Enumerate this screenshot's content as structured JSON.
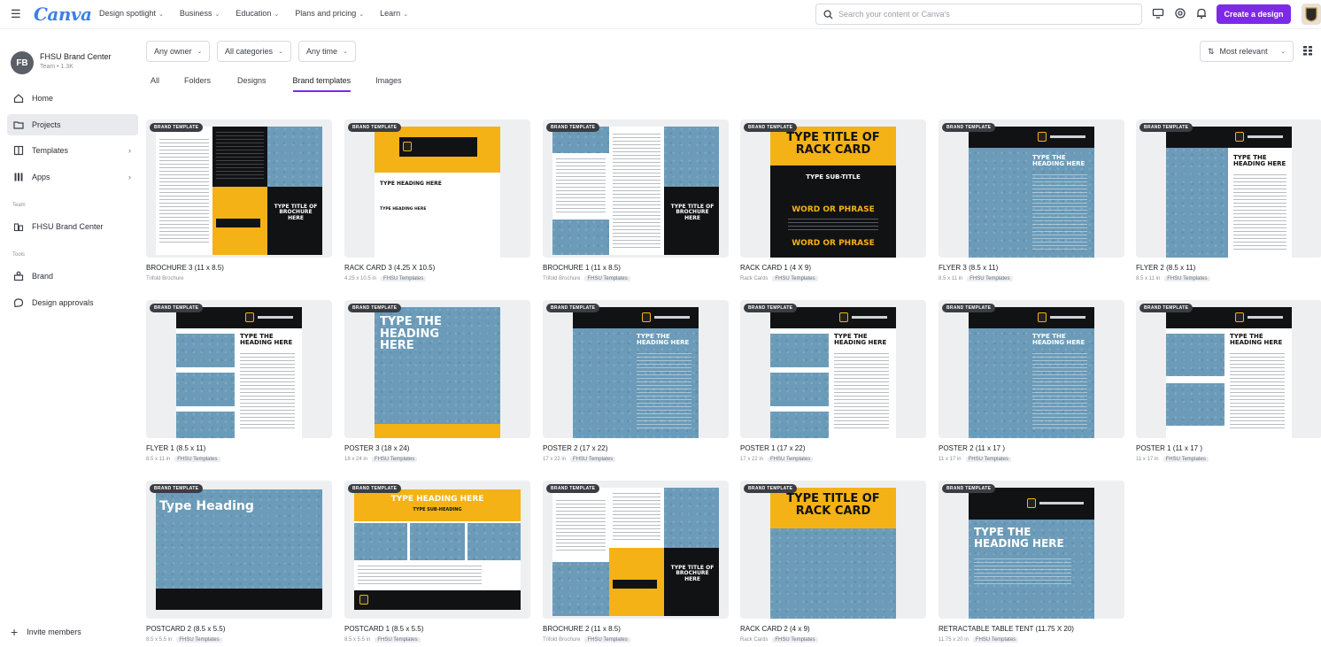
{
  "topbar": {
    "logo": "Canva",
    "nav": [
      "Design spotlight",
      "Business",
      "Education",
      "Plans and pricing",
      "Learn"
    ],
    "search_placeholder": "Search your content or Canva's",
    "create_label": "Create a design"
  },
  "sidebar": {
    "team_initials": "FB",
    "team_name": "FHSU Brand Center",
    "team_sub": "Team • 1.3K",
    "items": [
      {
        "label": "Home",
        "icon": "home-icon"
      },
      {
        "label": "Projects",
        "icon": "folder-icon"
      },
      {
        "label": "Templates",
        "icon": "templates-icon"
      },
      {
        "label": "Apps",
        "icon": "apps-icon"
      }
    ],
    "teams_heading": "Team",
    "team_item": "FHSU Brand Center",
    "tools_heading": "Tools",
    "tools": [
      {
        "label": "Brand",
        "icon": "brand-icon"
      },
      {
        "label": "Design approvals",
        "icon": "approvals-icon"
      }
    ],
    "invite_label": "Invite members"
  },
  "filters": {
    "owner": "Any owner",
    "categories": "All categories",
    "time": "Any time",
    "sort": "Most relevant"
  },
  "tabs": [
    "All",
    "Folders",
    "Designs",
    "Brand templates",
    "Images"
  ],
  "active_tab": "Brand templates",
  "badge_label": "BRAND TEMPLATE",
  "cards": [
    {
      "title": "BROCHURE 3 (11 x 8.5)",
      "meta": "Trifold Brochure",
      "chip": ""
    },
    {
      "title": "RACK CARD 3 (4.25 X 10.5)",
      "meta": "4.25 x 10.5 in",
      "chip": "FHSU Templates"
    },
    {
      "title": "BROCHURE 1 (11 x 8.5)",
      "meta": "Trifold Brochure",
      "chip": "FHSU Templates"
    },
    {
      "title": "RACK CARD 1 (4 X 9)",
      "meta": "Rack Cards",
      "chip": "FHSU Templates"
    },
    {
      "title": "FLYER 3 (8.5 x 11)",
      "meta": "8.5 x 11 in",
      "chip": "FHSU Templates"
    },
    {
      "title": "FLYER 2 (8.5 x 11)",
      "meta": "8.5 x 11 in",
      "chip": "FHSU Templates"
    },
    {
      "title": "FLYER 1 (8.5 x 11)",
      "meta": "8.5 x 11 in",
      "chip": "FHSU Templates"
    },
    {
      "title": "POSTER 3 (18 x 24)",
      "meta": "18 x 24 in",
      "chip": "FHSU Templates"
    },
    {
      "title": "POSTER 2 (17 x 22)",
      "meta": "17 x 22 in",
      "chip": "FHSU Templates"
    },
    {
      "title": "POSTER 1 (17 x 22)",
      "meta": "17 x 22 in",
      "chip": "FHSU Templates"
    },
    {
      "title": "POSTER 2 (11 x 17 )",
      "meta": "11 x 17 in",
      "chip": "FHSU Templates"
    },
    {
      "title": "POSTER 1 (11 x 17 )",
      "meta": "11 x 17 in",
      "chip": "FHSU Templates"
    },
    {
      "title": "POSTCARD 2 (8.5 x 5.5)",
      "meta": "8.5 x 5.5 in",
      "chip": "FHSU Templates"
    },
    {
      "title": "POSTCARD 1 (8.5 x 5.5)",
      "meta": "8.5 x 5.5 in",
      "chip": "FHSU Templates"
    },
    {
      "title": "BROCHURE 2 (11 x 8.5)",
      "meta": "Trifold Brochure",
      "chip": "FHSU Templates"
    },
    {
      "title": "RACK CARD 2 (4 x 9)",
      "meta": "Rack Cards",
      "chip": "FHSU Templates"
    },
    {
      "title": "RETRACTABLE TABLE TENT (11.75 X 20)",
      "meta": "11.75 x 20 in",
      "chip": "FHSU Templates"
    }
  ],
  "thumb_text": {
    "type_heading_here": "TYPE HEADING HERE",
    "type_title_rack": "TYPE TITLE OF RACK CARD",
    "type_sub_title": "TYPE SUB-TITLE",
    "word_or_phrase": "WORD OR PHRASE",
    "type_the_heading": "TYPE THE HEADING HERE",
    "type_heading": "Type Heading",
    "type_sub_heading": "TYPE SUB-HEADING",
    "type_title_brochure": "TYPE TITLE OF BROCHURE HERE"
  },
  "colors": {
    "accent": "#7d2ae8",
    "fhsu_gold": "#f4b217",
    "fhsu_black": "#111214",
    "fhsu_blue": "#6b9bb8"
  }
}
